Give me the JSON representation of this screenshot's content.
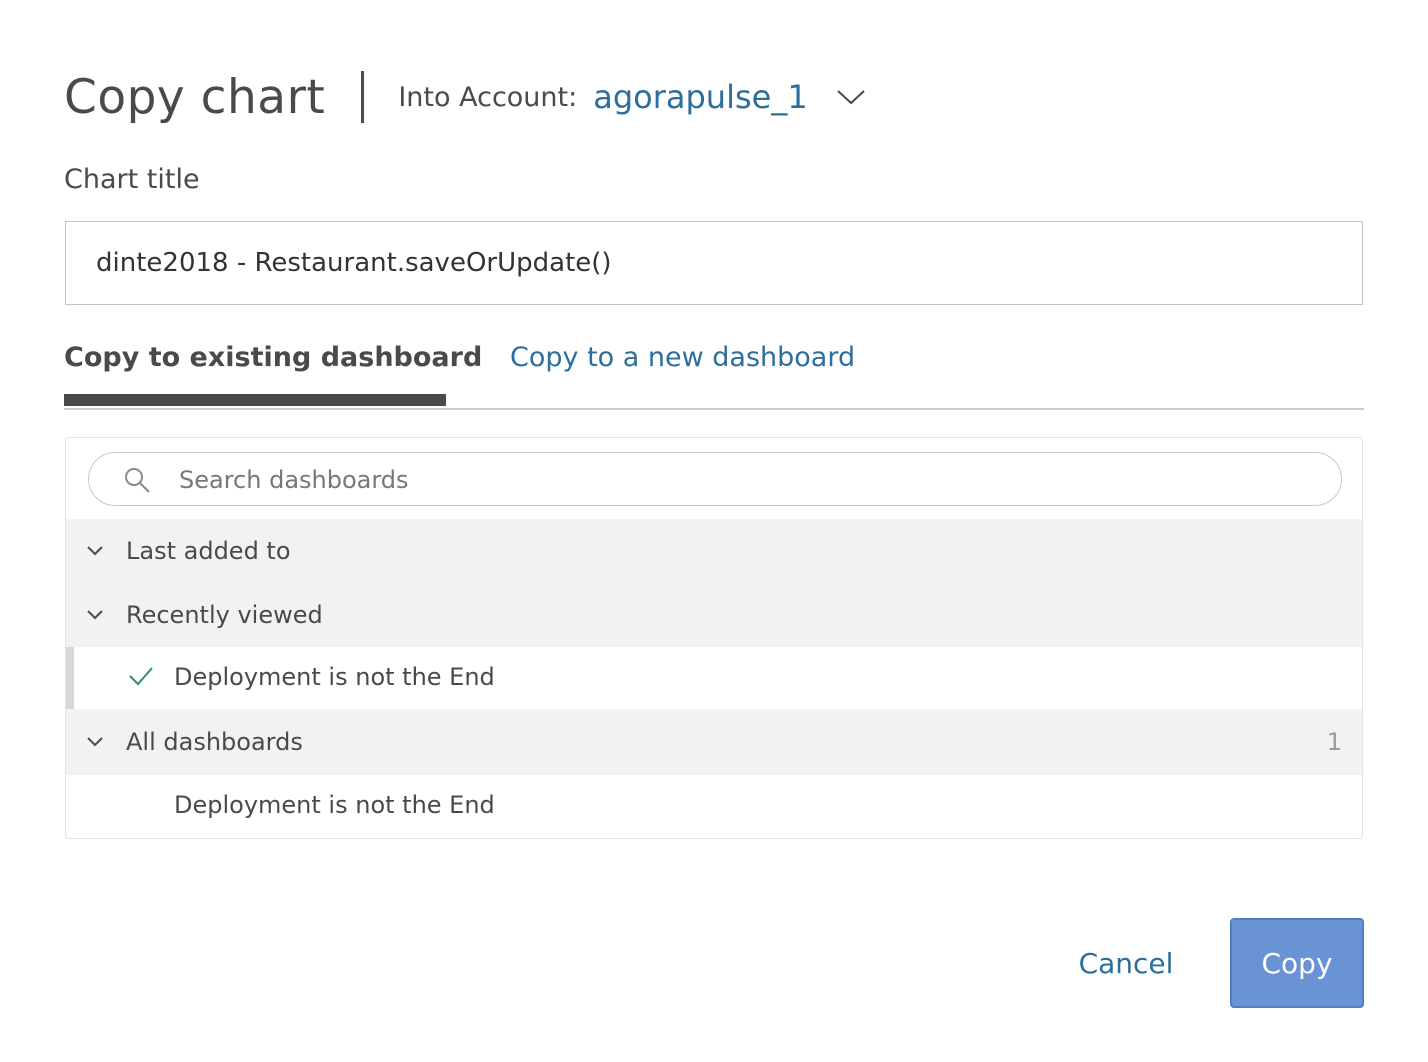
{
  "dialog": {
    "title": "Copy chart",
    "account_label": "Into Account:",
    "account_value": "agorapulse_1"
  },
  "chart_title": {
    "label": "Chart title",
    "value": "dinte2018 - Restaurant.saveOrUpdate()"
  },
  "tabs": [
    {
      "label": "Copy to existing dashboard",
      "active": true
    },
    {
      "label": "Copy to a new dashboard",
      "active": false
    }
  ],
  "search": {
    "placeholder": "Search dashboards",
    "value": ""
  },
  "groups": {
    "last_added": {
      "label": "Last added to"
    },
    "recently_viewed": {
      "label": "Recently viewed",
      "items": [
        {
          "label": "Deployment is not the End",
          "selected": true
        }
      ]
    },
    "all_dashboards": {
      "label": "All dashboards",
      "count": "1",
      "items": [
        {
          "label": "Deployment is not the End",
          "selected": false
        }
      ]
    }
  },
  "footer": {
    "cancel_label": "Cancel",
    "copy_label": "Copy"
  },
  "colors": {
    "link": "#2c6e9c",
    "primary_button": "#6a93d6",
    "check": "#2e8b7a",
    "group_row_bg": "#f2f2f2"
  },
  "icons": [
    "chevron-down-icon",
    "search-icon",
    "check-icon"
  ]
}
